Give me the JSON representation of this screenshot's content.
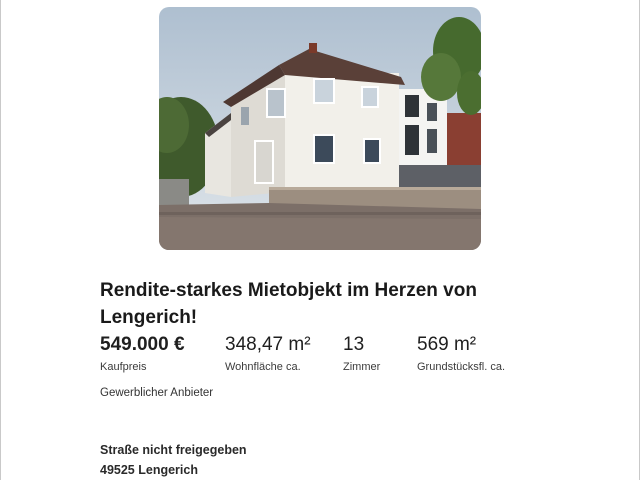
{
  "listing": {
    "photo_alt": "Mehrfamilienhaus",
    "title": "Rendite-starkes Mietobjekt im Herzen von Lengerich!",
    "facts": [
      {
        "value": "549.000 €",
        "label": "Kaufpreis"
      },
      {
        "value": "348,47 m²",
        "label": "Wohnfläche ca."
      },
      {
        "value": "13",
        "label": "Zimmer"
      },
      {
        "value": "569 m²",
        "label": "Grundstücksfl. ca."
      }
    ],
    "provider": "Gewerblicher Anbieter",
    "address": {
      "street": "Straße nicht freigegeben",
      "city": "49525 Lengerich"
    }
  }
}
